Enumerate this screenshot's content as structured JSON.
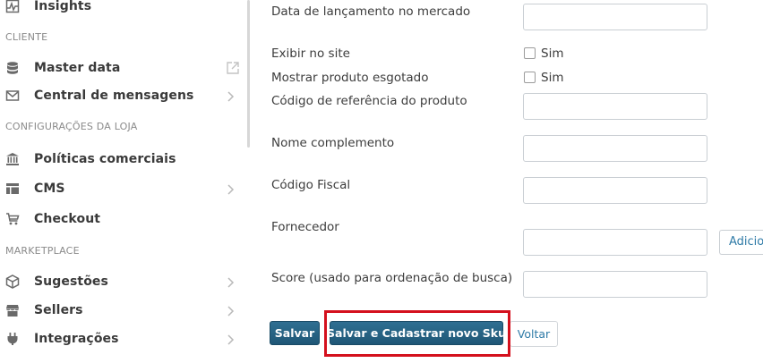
{
  "sidebar": {
    "items": [
      {
        "label": "Insights",
        "icon": "chart-pulse-icon"
      },
      {
        "label": "Master data",
        "icon": "database-icon",
        "trailing": "external-link-icon"
      },
      {
        "label": "Central de mensagens",
        "icon": "mail-icon",
        "trailing": "chevron-right-icon"
      },
      {
        "label": "Políticas comerciais",
        "icon": "bank-icon"
      },
      {
        "label": "CMS",
        "icon": "layout-icon",
        "trailing": "chevron-right-icon"
      },
      {
        "label": "Checkout",
        "icon": "cart-icon"
      },
      {
        "label": "Sugestões",
        "icon": "box-icon",
        "trailing": "chevron-right-icon"
      },
      {
        "label": "Sellers",
        "icon": "store-icon",
        "trailing": "chevron-right-icon"
      },
      {
        "label": "Integrações",
        "icon": "plug-icon",
        "trailing": "chevron-right-icon"
      }
    ],
    "sections": {
      "cliente": "CLIENTE",
      "configuracoes": "CONFIGURAÇÕES DA LOJA",
      "marketplace": "MARKETPLACE"
    }
  },
  "form": {
    "launch_date_label": "Data de lançamento no mercado",
    "launch_date_value": "",
    "show_on_site_label": "Exibir no site",
    "show_on_site_option": "Sim",
    "show_on_site_checked": false,
    "show_sold_out_label": "Mostrar produto esgotado",
    "show_sold_out_option": "Sim",
    "show_sold_out_checked": false,
    "ref_code_label": "Código de referência do produto",
    "ref_code_value": "",
    "name_complement_label": "Nome complemento",
    "name_complement_value": "",
    "fiscal_code_label": "Código Fiscal",
    "fiscal_code_value": "",
    "supplier_label": "Fornecedor",
    "supplier_value": "",
    "supplier_add_button": "Adicio",
    "score_label": "Score (usado para ordenação de busca)",
    "score_value": ""
  },
  "actions": {
    "save": "Salvar",
    "save_and_new_sku": "Salvar e Cadastrar novo Sku",
    "back": "Voltar"
  },
  "colors": {
    "primary_button": "#1f5776",
    "link_blue": "#2f7ba7",
    "highlight_red": "#d4101d"
  }
}
